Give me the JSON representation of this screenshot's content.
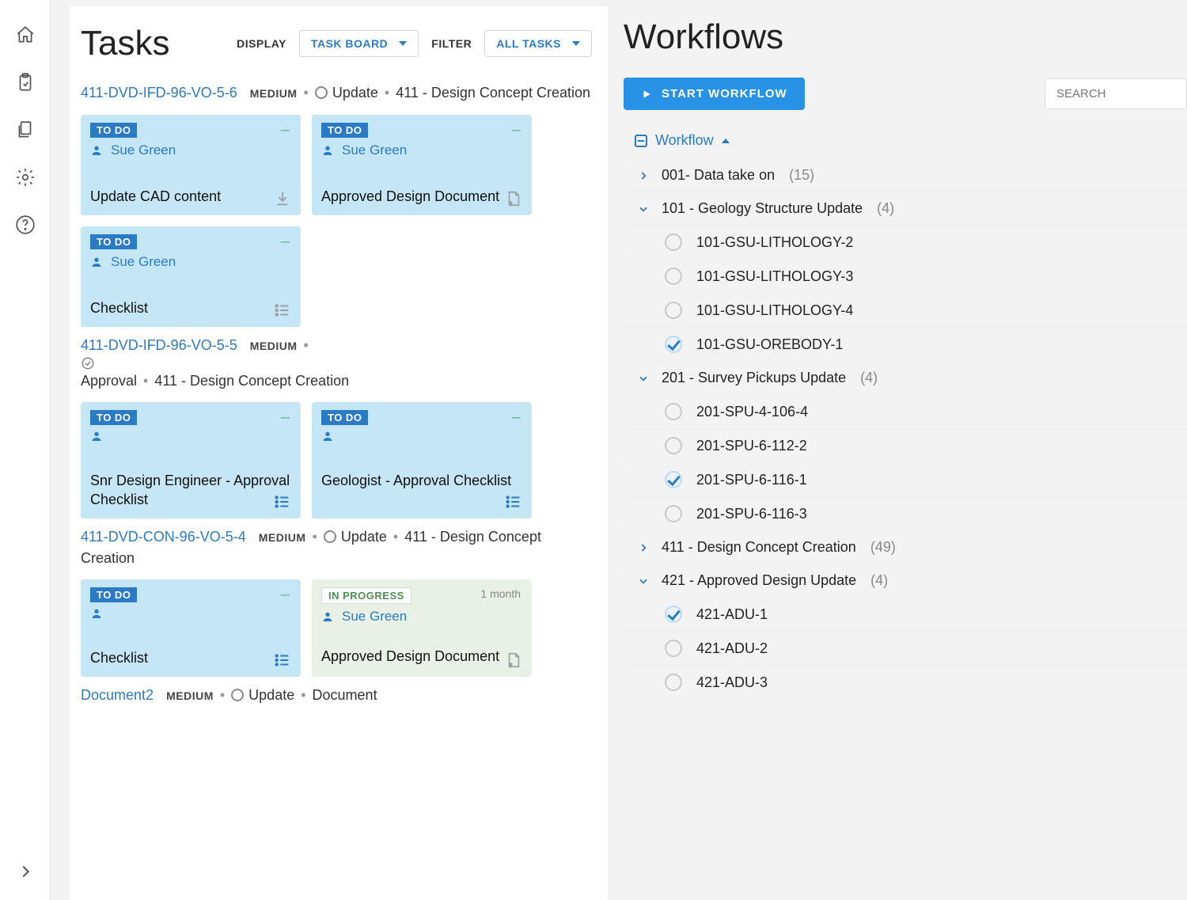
{
  "sidebar": {
    "icons": [
      "home",
      "clipboard",
      "documents",
      "settings",
      "help"
    ]
  },
  "tasks": {
    "title": "Tasks",
    "display_label": "DISPLAY",
    "display_value": "TASK BOARD",
    "filter_label": "FILTER",
    "filter_value": "ALL TASKS",
    "groups": [
      {
        "code": "411-DVD-IFD-96-VO-5-6",
        "priority": "MEDIUM",
        "stage_icon": "ring",
        "stage": "Update",
        "workflow": "411 - Design Concept Creation",
        "cards": [
          {
            "status": "TO DO",
            "style": "blue",
            "person": "Sue Green",
            "title": "Update CAD content",
            "foot": "download"
          },
          {
            "status": "TO DO",
            "style": "blue",
            "person": "Sue Green",
            "title": "Approved Design Document",
            "foot": "doc"
          },
          {
            "status": "TO DO",
            "style": "blue",
            "person": "Sue Green",
            "title": "Checklist",
            "foot": "list"
          }
        ]
      },
      {
        "code": "411-DVD-IFD-96-VO-5-5",
        "priority": "MEDIUM",
        "stage_icon": "check",
        "stage": "Approval",
        "workflow": "411 - Design Concept Creation",
        "cards": [
          {
            "status": "TO DO",
            "style": "blue",
            "person": "",
            "title": "Snr Design Engineer - Approval Checklist",
            "foot": "list-blue"
          },
          {
            "status": "TO DO",
            "style": "blue",
            "person": "",
            "title": "Geologist - Approval Checklist",
            "foot": "list-blue"
          }
        ]
      },
      {
        "code": "411-DVD-CON-96-VO-5-4",
        "priority": "MEDIUM",
        "stage_icon": "ring",
        "stage": "Update",
        "workflow": "411 - Design Concept Creation",
        "cards": [
          {
            "status": "TO DO",
            "style": "blue",
            "person": "",
            "title": "Checklist",
            "foot": "list-blue"
          },
          {
            "status": "IN PROGRESS",
            "style": "green",
            "person": "Sue Green",
            "meta": "1 month",
            "title": "Approved Design Document",
            "foot": "doc"
          }
        ]
      },
      {
        "code": "Document2",
        "priority": "MEDIUM",
        "stage_icon": "ring",
        "stage": "Update",
        "workflow": "Document",
        "cards": []
      }
    ]
  },
  "workflows": {
    "title": "Workflows",
    "start_label": "START WORKFLOW",
    "search_placeholder": "SEARCH",
    "root_label": "Workflow",
    "nodes": [
      {
        "expand": "right",
        "label": "001- Data take on",
        "count": "(15)",
        "leaves": []
      },
      {
        "expand": "down",
        "label": "101 - Geology Structure Update",
        "count": "(4)",
        "leaves": [
          {
            "label": "101-GSU-LITHOLOGY-2",
            "checked": false
          },
          {
            "label": "101-GSU-LITHOLOGY-3",
            "checked": false
          },
          {
            "label": "101-GSU-LITHOLOGY-4",
            "checked": false
          },
          {
            "label": "101-GSU-OREBODY-1",
            "checked": true
          }
        ]
      },
      {
        "expand": "down",
        "label": "201 - Survey Pickups Update",
        "count": "(4)",
        "leaves": [
          {
            "label": "201-SPU-4-106-4",
            "checked": false
          },
          {
            "label": "201-SPU-6-112-2",
            "checked": false
          },
          {
            "label": "201-SPU-6-116-1",
            "checked": true
          },
          {
            "label": "201-SPU-6-116-3",
            "checked": false
          }
        ]
      },
      {
        "expand": "right",
        "label": "411 - Design Concept Creation",
        "count": "(49)",
        "leaves": []
      },
      {
        "expand": "down",
        "label": "421 - Approved Design Update",
        "count": "(4)",
        "leaves": [
          {
            "label": "421-ADU-1",
            "checked": true
          },
          {
            "label": "421-ADU-2",
            "checked": false
          },
          {
            "label": "421-ADU-3",
            "checked": false
          }
        ]
      }
    ]
  }
}
